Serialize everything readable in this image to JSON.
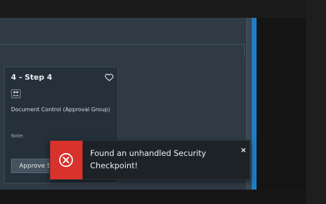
{
  "card": {
    "title": "4 - Step 4",
    "role": "Document Control (Approval Group)",
    "note_label": "Note:",
    "approve_label": "Approve Step"
  },
  "toast": {
    "message_line1": "Found an unhandled Security",
    "message_line2": "Checkpoint!",
    "close_glyph": "×"
  },
  "colors": {
    "panel": "#2f3a44",
    "card": "#25303a",
    "accent": "#1f7fc4",
    "error": "#d9312b",
    "toast_bg": "#1d2227"
  }
}
